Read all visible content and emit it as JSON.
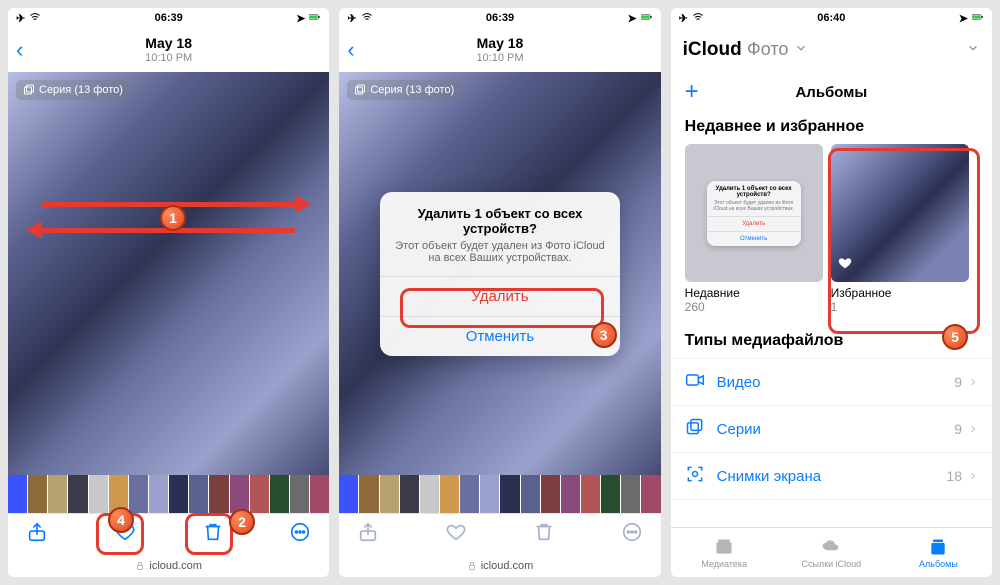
{
  "footer_url": "icloud.com",
  "screen1": {
    "status": {
      "time": "06:39",
      "plane": true
    },
    "nav": {
      "date": "May 18",
      "time": "10:10 PM"
    },
    "series_chip": "Серия (13 фото)"
  },
  "screen2": {
    "status": {
      "time": "06:39"
    },
    "nav": {
      "date": "May 18",
      "time": "10:10 PM"
    },
    "series_chip": "Серия (13 фото)",
    "dialog": {
      "title": "Удалить 1 объект со всех устройств?",
      "text": "Этот объект будет удален из Фото iCloud на всех Ваших устройствах.",
      "delete": "Удалить",
      "cancel": "Отменить"
    }
  },
  "screen3": {
    "status": {
      "time": "06:40"
    },
    "brand": "iCloud",
    "brand_sub": "Фото",
    "title": "Альбомы",
    "section1": "Недавнее и избранное",
    "albums": [
      {
        "name": "Недавние",
        "count": "260"
      },
      {
        "name": "Избранное",
        "count": "1"
      }
    ],
    "section2": "Типы медиафайлов",
    "rows": [
      {
        "icon": "video",
        "label": "Видео",
        "count": "9"
      },
      {
        "icon": "burst",
        "label": "Серии",
        "count": "9"
      },
      {
        "icon": "screenshot",
        "label": "Снимки экрана",
        "count": "18"
      }
    ],
    "tabs": [
      {
        "label": "Медиатека",
        "active": false
      },
      {
        "label": "Ссылки iCloud",
        "active": false
      },
      {
        "label": "Альбомы",
        "active": true
      }
    ]
  },
  "callouts": {
    "c1": "1",
    "c2": "2",
    "c3": "3",
    "c4": "4",
    "c5": "5"
  },
  "mini_dialog": {
    "title": "Удалить 1 объект со всех устройств?",
    "sub": "Этот объект будет удален из Фото iCloud на всех Ваших устройствах.",
    "del": "Удалить",
    "cancel": "Отменить"
  },
  "filmstrip_colors": [
    "#3b52ff",
    "#8f6a3a",
    "#b8a170",
    "#3a3a4a",
    "#c8c8c8",
    "#d0984d",
    "#6a6fa0",
    "#9aa1cc",
    "#2c3050",
    "#5a618f",
    "#7b3f3f",
    "#8a4a7a",
    "#b45555",
    "#264d2d",
    "#6b6b6b",
    "#a04a6a"
  ]
}
